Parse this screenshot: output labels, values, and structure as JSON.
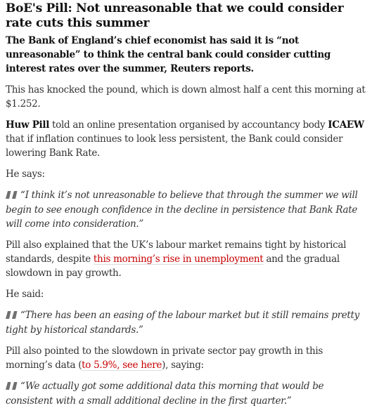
{
  "article": {
    "headline": "BoE's Pill: Not unreasonable that we could consider rate cuts this summer",
    "standfirst": "The Bank of England’s chief economist has said it is “not unreasonable” to think the central bank could consider cutting interest rates over the summer, Reuters reports.",
    "para1": "This has knocked the pound, which is down almost half a cent this morning at $1.252.",
    "para2": {
      "name": "Huw Pill",
      "text_a": " told an online presentation organised by accountancy body ",
      "org": "ICAEW",
      "text_b": " that if inflation continues to look less persistent, the Bank could consider lowering Bank Rate."
    },
    "says1": "He says:",
    "quote1": "“I think it’s not unreasonable to believe that through the summer we will begin to see enough confidence in the decline in persistence that Bank Rate will come into consideration.”",
    "para3": {
      "text_a": "Pill also explained that the UK’s labour market remains tight by historical standards, despite ",
      "link": "this morning’s rise in unemployment",
      "text_b": " and the gradual slowdown in pay growth."
    },
    "says2": "He said:",
    "quote2": "“There has been an easing of the labour market but it still remains pretty tight by historical standards.”",
    "para4": {
      "text_a": "Pill also pointed to the slowdown in private sector pay growth in this morning’s data (",
      "link": "to 5.9%, see here",
      "text_b": "), saying:"
    },
    "quote3": "“We actually got some additional data this morning that would be consistent with a small additional decline in the first quarter.”"
  },
  "icons": {
    "quote": "quote-mark-icon"
  },
  "colors": {
    "link": "#c70000",
    "quote_icon": "#707070",
    "text": "#333333",
    "heading": "#121212"
  }
}
